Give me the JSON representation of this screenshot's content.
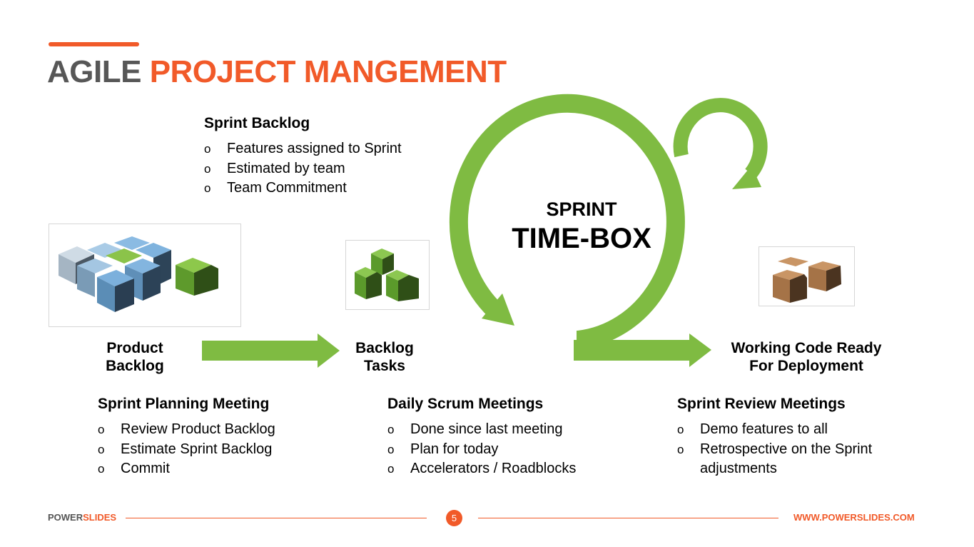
{
  "slide": {
    "title_part1": "AGILE",
    "title_part2": "PROJECT MANGEMENT",
    "accent_color": "#f15a29",
    "arrow_color": "#7fbb42"
  },
  "sprint_backlog": {
    "heading": "Sprint Backlog",
    "items": [
      "Features assigned to Sprint",
      "Estimated by team",
      "Team Commitment"
    ]
  },
  "sprint_center": {
    "line1": "SPRINT",
    "line2": "TIME-BOX"
  },
  "stages": [
    {
      "label_line1": "Product",
      "label_line2": "Backlog",
      "icon": "product-backlog-cubes-icon"
    },
    {
      "label_line1": "Backlog",
      "label_line2": "Tasks",
      "icon": "backlog-tasks-cubes-icon"
    },
    {
      "label_line1": "Working Code Ready",
      "label_line2": "For Deployment",
      "icon": "working-code-boxes-icon"
    }
  ],
  "meetings": [
    {
      "heading": "Sprint Planning Meeting",
      "items": [
        "Review Product Backlog",
        "Estimate Sprint Backlog",
        "Commit"
      ]
    },
    {
      "heading": "Daily Scrum Meetings",
      "items": [
        "Done since last meeting",
        "Plan for today",
        "Accelerators / Roadblocks"
      ]
    },
    {
      "heading": "Sprint Review Meetings",
      "items": [
        "Demo features to all",
        "Retrospective on the Sprint",
        "adjustments"
      ]
    }
  ],
  "bullet_glyph": "o",
  "footer": {
    "brand_part1": "POWER",
    "brand_part2": "SLIDES",
    "page_number": "5",
    "url": "WWW.POWERSLIDES.COM"
  }
}
